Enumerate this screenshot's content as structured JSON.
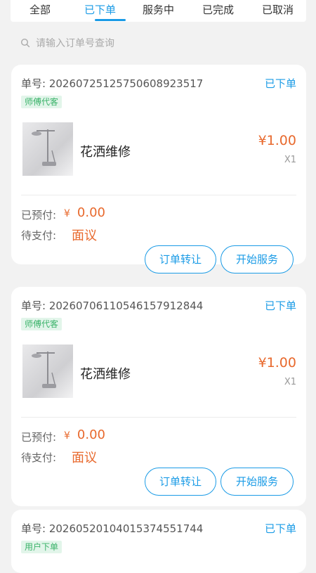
{
  "tabs": [
    {
      "label": "全部",
      "active": false
    },
    {
      "label": "已下单",
      "active": true
    },
    {
      "label": "服务中",
      "active": false
    },
    {
      "label": "已完成",
      "active": false
    },
    {
      "label": "已取消",
      "active": false
    }
  ],
  "search": {
    "placeholder": "请输入订单号查询",
    "icon": "search-icon"
  },
  "orders": [
    {
      "order_no_label": "单号:",
      "order_no": "20260725125750608923517",
      "status": "已下单",
      "tag": "师傅代客",
      "product_name": "花洒维修",
      "price": "¥1.00",
      "quantity": "X1",
      "prepaid_label": "已预付:",
      "prepaid_currency": "¥",
      "prepaid_amount": "0.00",
      "topay_label": "待支付:",
      "topay_value": "面议",
      "transfer_label": "订单转让",
      "start_label": "开始服务"
    },
    {
      "order_no_label": "单号:",
      "order_no": "20260706110546157912844",
      "status": "已下单",
      "tag": "师傅代客",
      "product_name": "花洒维修",
      "price": "¥1.00",
      "quantity": "X1",
      "prepaid_label": "已预付:",
      "prepaid_currency": "¥",
      "prepaid_amount": "0.00",
      "topay_label": "待支付:",
      "topay_value": "面议",
      "transfer_label": "订单转让",
      "start_label": "开始服务"
    },
    {
      "order_no_label": "单号:",
      "order_no": "20260520104015374551744",
      "status": "已下单",
      "tag": "用户下单"
    }
  ],
  "colors": {
    "accent": "#1a9be6",
    "price": "#e8692d",
    "tag_text": "#3bb36a",
    "tag_bg": "#e2f5ea"
  }
}
